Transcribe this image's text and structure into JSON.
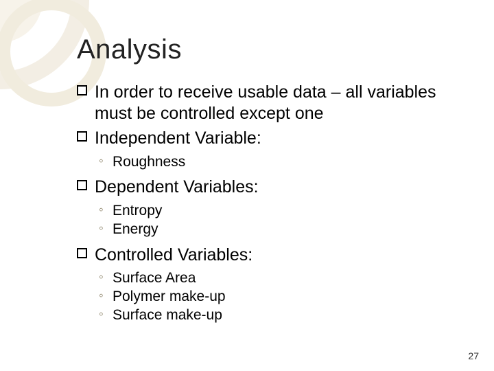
{
  "title": "Analysis",
  "bullets": {
    "intro": "In order to receive usable data – all variables must be controlled except one",
    "independent": {
      "label": "Independent Variable:",
      "items": [
        "Roughness"
      ]
    },
    "dependent": {
      "label": "Dependent Variables:",
      "items": [
        "Entropy",
        "Energy"
      ]
    },
    "controlled": {
      "label": "Controlled Variables:",
      "items": [
        "Surface Area",
        "Polymer make-up",
        "Surface make-up"
      ]
    }
  },
  "page_number": "27"
}
